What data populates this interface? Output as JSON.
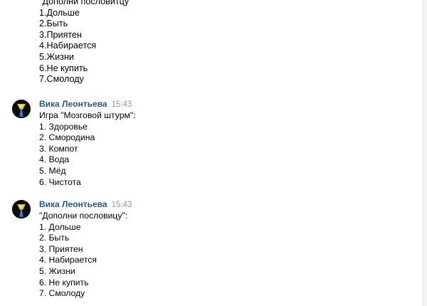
{
  "messages": [
    {
      "author": "",
      "time": "",
      "lines": [
        "\"Дополни пословитцу\"",
        "1.Дольше",
        "2.Быть",
        "3.Приятен",
        "4.Набирается",
        "5.Жизни",
        "6.Не купить",
        "7.Смолоду"
      ]
    },
    {
      "author": "Вика Леонтьева",
      "time": "15:43",
      "lines": [
        "Игра \"Мозговой штурм\":",
        "1. Здоровье",
        "2. Смородина",
        "3. Компот",
        "4. Вода",
        "5. Мёд",
        "6. Чистота"
      ]
    },
    {
      "author": "Вика Леонтьева",
      "time": "15:43",
      "lines": [
        "\"Дополни пословицу\":",
        "1. Дольше",
        "2. Быть",
        "3. Приятен",
        "4. Набирается",
        "5. Жизни",
        "6. Не купить",
        "7. Смолоду"
      ]
    }
  ],
  "colors": {
    "author": "#2a5885",
    "time": "#939393",
    "text": "#000000",
    "background": "#ffffff"
  }
}
